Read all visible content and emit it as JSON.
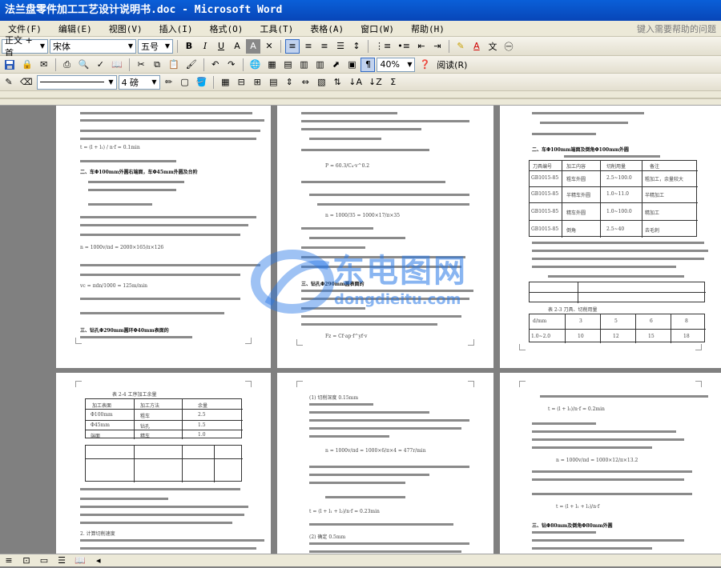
{
  "window": {
    "title": "法兰盘零件加工工艺设计说明书.doc - Microsoft Word"
  },
  "menu": {
    "items": [
      "文件(F)",
      "编辑(E)",
      "视图(V)",
      "插入(I)",
      "格式(O)",
      "工具(T)",
      "表格(A)",
      "窗口(W)",
      "帮助(H)"
    ],
    "help_placeholder": "键入需要帮助的问题"
  },
  "toolbar": {
    "style_value": "正文 + 首",
    "font_value": "宋体",
    "size_value": "五号",
    "bold": "B",
    "italic": "I",
    "underline": "U",
    "zoom_value": "40%",
    "reading_label": "阅读(R)",
    "line_weight": "4 磅",
    "sum_label": "Σ"
  },
  "watermark": {
    "cn": "东电图网",
    "en": "dongdieitu.com"
  },
  "colors": {
    "title_bar": "#0a5fd8",
    "chrome": "#ece9d8",
    "doc_bg": "#808080",
    "watermark": "#2878e6"
  },
  "pages": {
    "p1": {
      "heading1": "二、车Φ100mm外圆右端面，车Φ45mm外圆及台阶",
      "heading2": "三、钻孔Φ290mm圆环Φ40mm表面的",
      "formula1": "t = (l + l₁) / n·f = 0.1min",
      "formula2": "n = 1000v/πd = 2000×165/π×126",
      "formula3": "vc = πdn/1000 = 125m/min"
    },
    "p2": {
      "heading1": "三、钻孔Φ290mm圆表面的",
      "formula1": "P = 60.3/C₄·v^0.2",
      "formula2": "n = 1000/35 = 1000×17/π×35",
      "formula3": "Fz = Cf·ap·f^yf·v"
    },
    "p3": {
      "heading1": "二、车Φ100mm端面及倒角Φ100mm外圆",
      "table_header": [
        "刀具编号",
        "加工内容",
        "切削用量",
        "备注"
      ],
      "table_rows": [
        [
          "GB1015-85",
          "粗车外圆",
          "2.5~100.0",
          "粗加工，余量较大"
        ],
        [
          "GB1015-85",
          "半精车外圆",
          "1.0~11.0",
          "半精加工"
        ],
        [
          "GB1015-85",
          "精车外圆",
          "1.0~100.0",
          "精加工"
        ],
        [
          "GB1015-85",
          "倒角",
          "2.5~40",
          "去毛刺"
        ]
      ],
      "caption1": "表 2-3 刀具、切削用量",
      "small_table_header": [
        "d/mm",
        "3",
        "5",
        "6",
        "8"
      ],
      "small_table_rows": [
        [
          "1.0~2.0",
          "10",
          "12",
          "15",
          "18"
        ]
      ]
    },
    "p4": {
      "caption": "表 2-4 工序加工余量",
      "table_header": [
        "加工表面",
        "加工方法",
        "余量"
      ],
      "table_rows": [
        [
          "Φ100mm",
          "粗车",
          "2.5"
        ],
        [
          "Φ45mm",
          "钻孔",
          "1.5"
        ],
        [
          "端面",
          "精车",
          "1.0"
        ]
      ],
      "formula1": "2. 计算切削速度"
    },
    "p5": {
      "formula1": "(1) 切削深度 0.15mm",
      "formula2": "n = 1000v/πd = 1000×6/π×4 = 477r/min",
      "formula3": "t = (l + l₁ + l₂)/n·f = 0.23min",
      "formula4": "(2) 确定 0.5mm"
    },
    "p6": {
      "formula1": "t = (l + l₁)/n·f = 0.2min",
      "formula2": "n = 1000v/πd = 1000×12/π×13.2",
      "heading1": "三、钻Φ80mm及倒角Φ80mm外圆",
      "formula3": "t = (l + l₁ + l₂)/n·f"
    }
  }
}
